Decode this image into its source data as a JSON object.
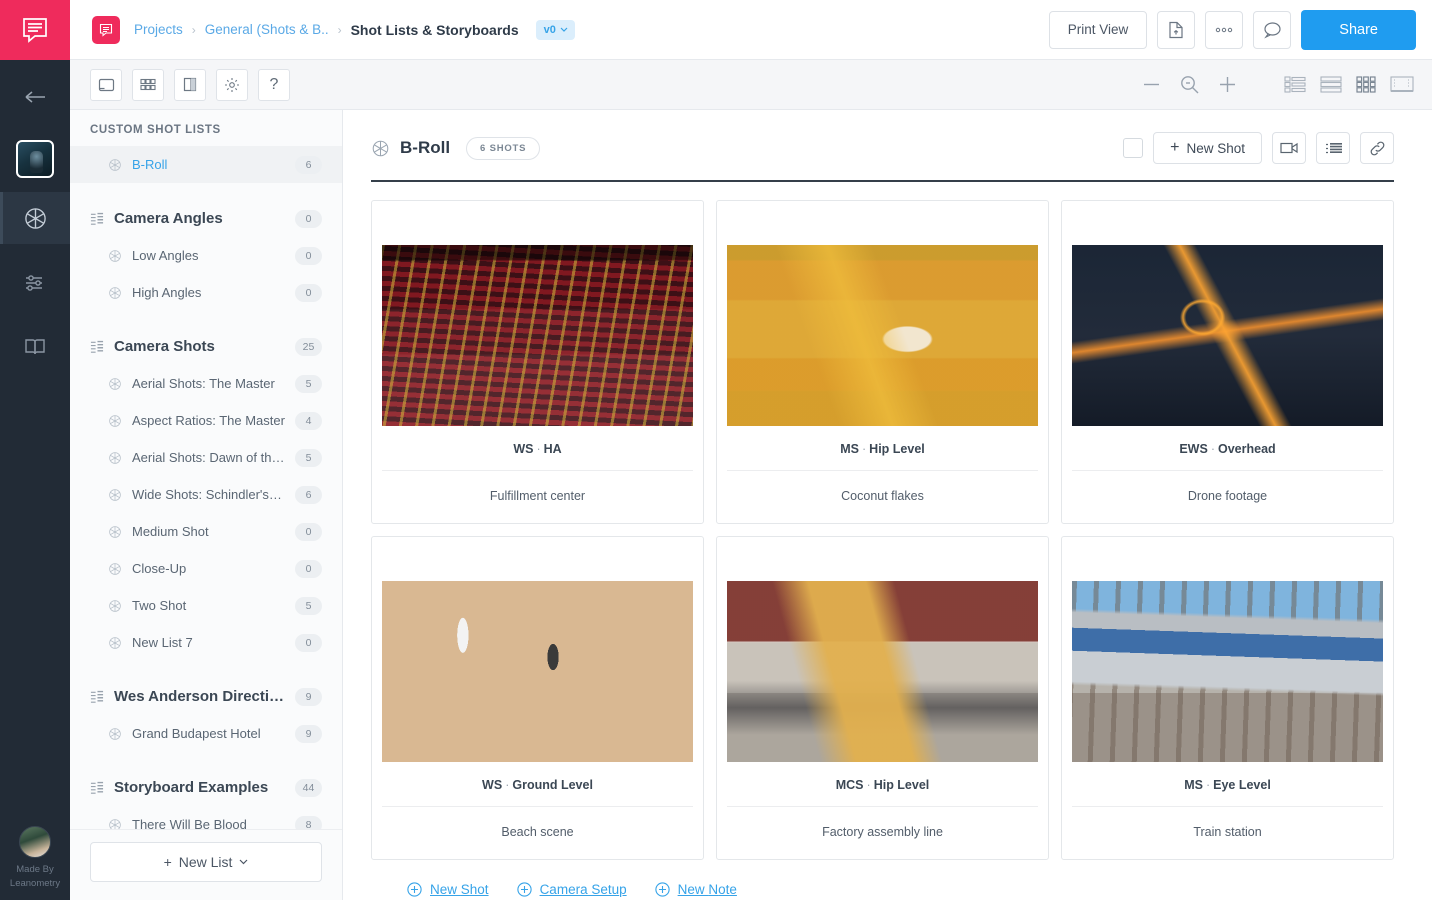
{
  "rail": {
    "logo_icon": "studiobinder-logo-icon",
    "back_icon": "back-arrow-icon",
    "thumb_name": "project-thumbnail",
    "items": [
      {
        "icon": "aperture-icon",
        "name": "shot-lists-nav"
      },
      {
        "icon": "sliders-icon",
        "name": "settings-nav"
      },
      {
        "icon": "book-icon",
        "name": "library-nav"
      }
    ],
    "made_by_line1": "Made By",
    "made_by_line2": "Leanometry",
    "avatar_name": "user-avatar"
  },
  "header": {
    "app_badge_icon": "studiobinder-mark-icon",
    "breadcrumbs": [
      {
        "label": "Projects",
        "type": "link"
      },
      {
        "label": "General (Shots & B..",
        "type": "link"
      },
      {
        "label": "Shot Lists & Storyboards",
        "type": "current"
      }
    ],
    "separator": "›",
    "version_label": "v0",
    "version_caret": "⌄",
    "print_view_label": "Print View",
    "export_icon": "file-export-icon",
    "more_icon": "more-dots-icon",
    "comment_icon": "comment-bubble-icon",
    "share_label": "Share",
    "accent_blue": "#1f9cf0",
    "brand_pink": "#ef2b5c"
  },
  "toolbar": {
    "left_tools": [
      {
        "icon": "fullscreen-icon",
        "name": "tool-fullscreen"
      },
      {
        "icon": "grid-layout-icon",
        "name": "tool-grid-layout"
      },
      {
        "icon": "sidebar-toggle-icon",
        "name": "tool-sidebar-toggle"
      },
      {
        "icon": "gear-icon",
        "name": "tool-settings"
      },
      {
        "icon": "question-mark-icon",
        "name": "tool-help"
      }
    ],
    "zoom_out_icon": "minus-icon",
    "zoom_fit_icon": "magnifier-icon",
    "zoom_in_icon": "plus-icon",
    "views": [
      {
        "icon": "list-detail-view-icon",
        "name": "view-list-detail"
      },
      {
        "icon": "rows-view-icon",
        "name": "view-rows"
      },
      {
        "icon": "grid-view-icon",
        "name": "view-grid",
        "active": true
      },
      {
        "icon": "board-view-icon",
        "name": "view-board"
      }
    ]
  },
  "sidebar": {
    "title": "CUSTOM SHOT LISTS",
    "rows": [
      {
        "label": "B-Roll",
        "count": "6",
        "kind": "child",
        "selected": true,
        "icon": "aperture-icon"
      },
      {
        "kind": "gap"
      },
      {
        "label": "Camera Angles",
        "count": "0",
        "kind": "group",
        "icon": "list-group-icon"
      },
      {
        "label": "Low Angles",
        "count": "0",
        "kind": "child",
        "icon": "aperture-icon"
      },
      {
        "label": "High Angles",
        "count": "0",
        "kind": "child",
        "icon": "aperture-icon"
      },
      {
        "kind": "gap"
      },
      {
        "label": "Camera Shots",
        "count": "25",
        "kind": "group",
        "icon": "list-group-icon"
      },
      {
        "label": "Aerial Shots: The Master",
        "count": "5",
        "kind": "child",
        "icon": "aperture-icon"
      },
      {
        "label": "Aspect Ratios: The Master",
        "count": "4",
        "kind": "child",
        "icon": "aperture-icon"
      },
      {
        "label": "Aerial Shots: Dawn of the Dead",
        "count": "5",
        "kind": "child",
        "icon": "aperture-icon"
      },
      {
        "label": "Wide Shots: Schindler's List",
        "count": "6",
        "kind": "child",
        "icon": "aperture-icon"
      },
      {
        "label": "Medium Shot",
        "count": "0",
        "kind": "child",
        "icon": "aperture-icon"
      },
      {
        "label": "Close-Up",
        "count": "0",
        "kind": "child",
        "icon": "aperture-icon"
      },
      {
        "label": "Two Shot",
        "count": "5",
        "kind": "child",
        "icon": "aperture-icon"
      },
      {
        "label": "New List 7",
        "count": "0",
        "kind": "child",
        "icon": "aperture-icon"
      },
      {
        "kind": "gap"
      },
      {
        "label": "Wes Anderson Directing ...",
        "count": "9",
        "kind": "group",
        "icon": "list-group-icon"
      },
      {
        "label": "Grand Budapest Hotel",
        "count": "9",
        "kind": "child",
        "icon": "aperture-icon"
      },
      {
        "kind": "gap"
      },
      {
        "label": "Storyboard Examples",
        "count": "44",
        "kind": "group",
        "icon": "list-group-icon"
      },
      {
        "label": "There Will Be Blood",
        "count": "8",
        "kind": "child",
        "icon": "aperture-icon"
      }
    ],
    "new_list_label": "New List",
    "new_list_plus": "+",
    "new_list_caret": "⌄"
  },
  "main": {
    "list_icon": "aperture-icon",
    "list_name": "B-Roll",
    "shots_pill": "6 SHOTS",
    "select_all_name": "select-all-checkbox",
    "new_shot_label": "New Shot",
    "new_shot_plus": "+",
    "camera_icon": "video-camera-icon",
    "insert_icon": "insert-row-icon",
    "link_icon": "link-icon",
    "cards": [
      {
        "meta_size": "WS",
        "meta_angle": "HA",
        "desc": "Fulfillment center",
        "art": "img-fulfillment"
      },
      {
        "meta_size": "MS",
        "meta_angle": "Hip Level",
        "desc": "Coconut flakes",
        "art": "img-coconut"
      },
      {
        "meta_size": "EWS",
        "meta_angle": "Overhead",
        "desc": "Drone footage",
        "art": "img-drone"
      },
      {
        "meta_size": "WS",
        "meta_angle": "Ground Level",
        "desc": "Beach scene",
        "art": "img-beach"
      },
      {
        "meta_size": "MCS",
        "meta_angle": "Hip Level",
        "desc": "Factory assembly line",
        "art": "img-factory"
      },
      {
        "meta_size": "MS",
        "meta_angle": "Eye Level",
        "desc": "Train station",
        "art": "img-train"
      }
    ],
    "meta_separator": "·",
    "bottom_links": [
      {
        "label_pre": "New ",
        "label_u": "S",
        "label_post": "hot",
        "name": "new-shot-link"
      },
      {
        "label_pre": "Camera Set",
        "label_u": "u",
        "label_post": "p",
        "name": "camera-setup-link"
      },
      {
        "label_pre": "New ",
        "label_u": "N",
        "label_post": "ote",
        "name": "new-note-link"
      }
    ]
  }
}
